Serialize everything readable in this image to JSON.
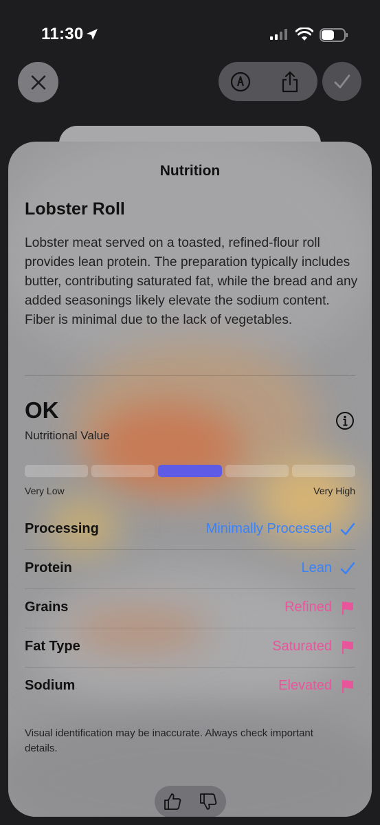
{
  "status_bar": {
    "time": "11:30"
  },
  "sheet": {
    "title": "Nutrition",
    "food_name": "Lobster Roll",
    "description": "Lobster meat served on a toasted, refined-flour roll provides lean protein. The preparation typically includes butter, contributing saturated fat, while the bread and any added seasonings likely elevate the sodium content. Fiber is minimal due to the lack of vegetables.",
    "rating": {
      "value": "OK",
      "label": "Nutritional Value",
      "scale_low": "Very Low",
      "scale_high": "Very High",
      "level_index": 2,
      "level_count": 5
    },
    "factors": [
      {
        "label": "Processing",
        "value": "Minimally Processed",
        "status": "good",
        "icon": "checkmark-icon"
      },
      {
        "label": "Protein",
        "value": "Lean",
        "status": "good",
        "icon": "checkmark-icon"
      },
      {
        "label": "Grains",
        "value": "Refined",
        "status": "warn",
        "icon": "flag-icon"
      },
      {
        "label": "Fat Type",
        "value": "Saturated",
        "status": "warn",
        "icon": "flag-icon"
      },
      {
        "label": "Sodium",
        "value": "Elevated",
        "status": "warn",
        "icon": "flag-icon"
      }
    ],
    "disclaimer": "Visual identification may be inaccurate. Always check important details."
  },
  "colors": {
    "good": "#3a82f7",
    "warn": "#e8559a",
    "scale_active": "#5e5ce6"
  },
  "icons": {
    "close": "close-icon",
    "markup": "markup-pen-icon",
    "share": "share-icon",
    "done": "checkmark-icon",
    "info": "info-icon",
    "thumbs_up": "thumbs-up-icon",
    "thumbs_down": "thumbs-down-icon"
  }
}
